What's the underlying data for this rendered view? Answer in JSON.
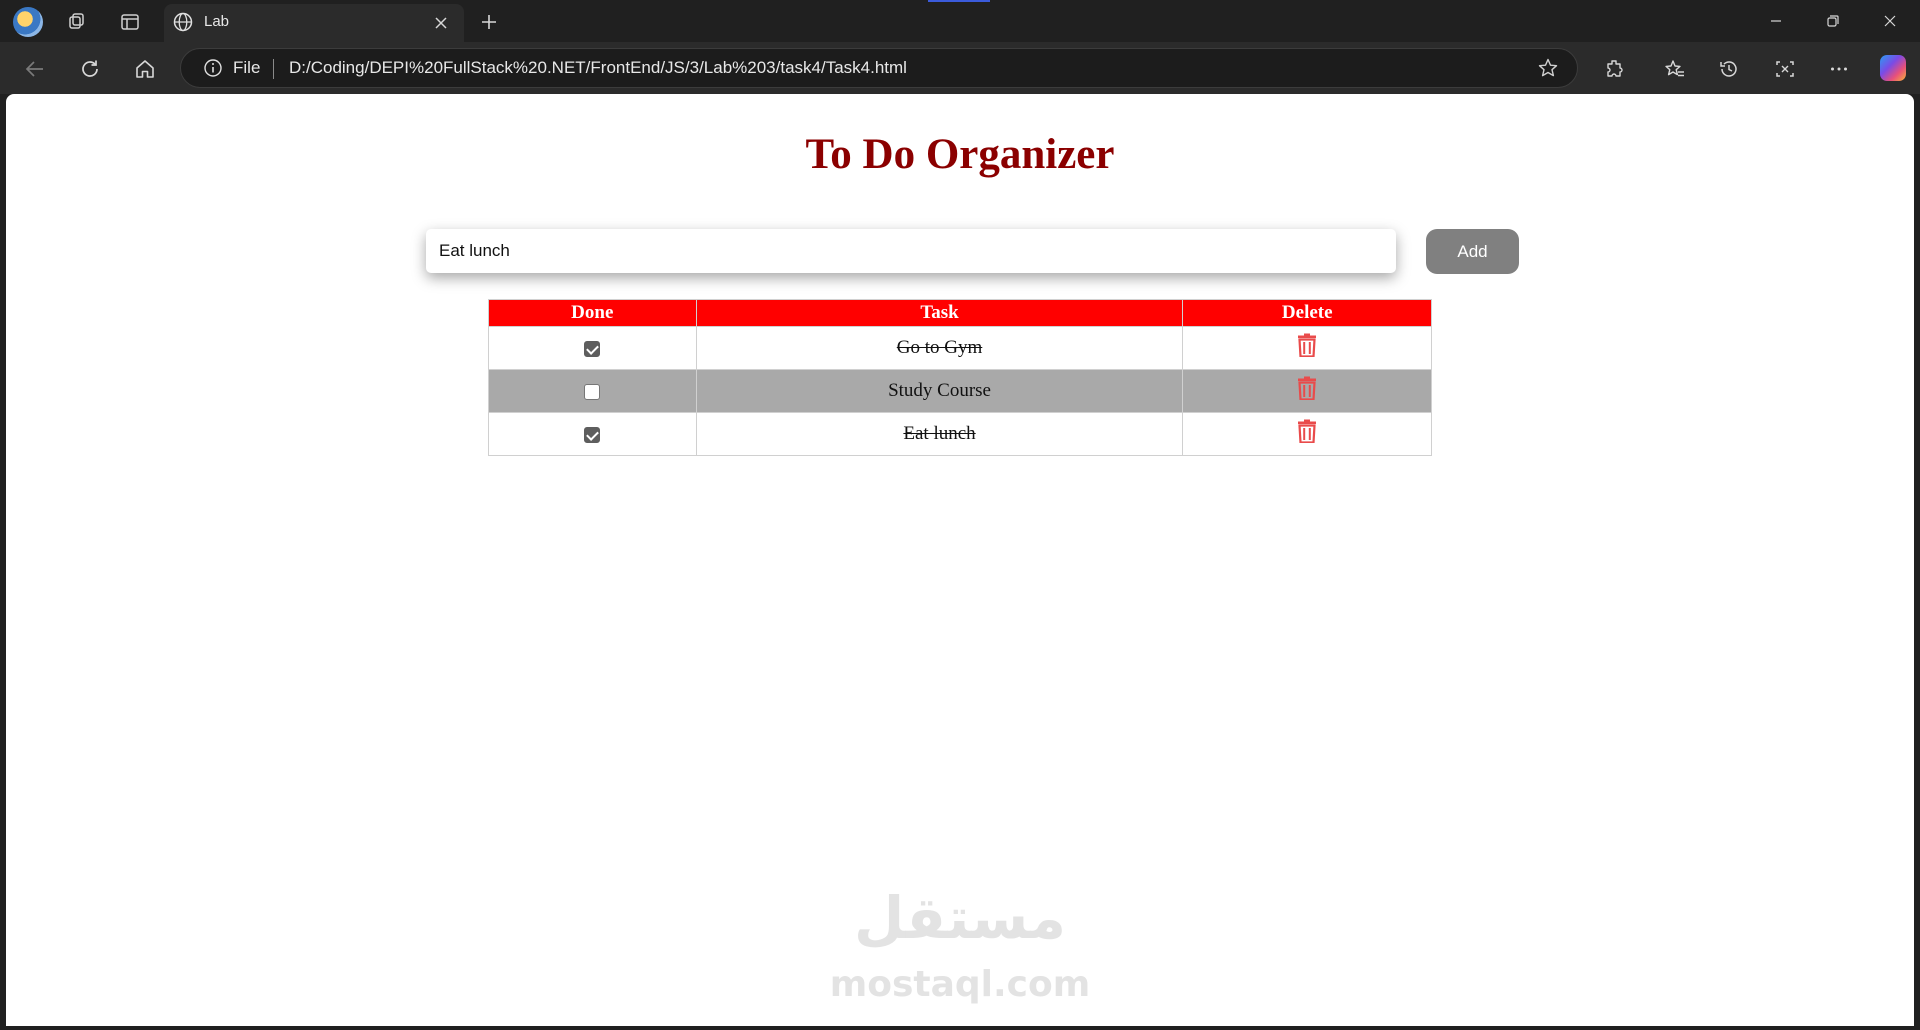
{
  "browser": {
    "tab_title": "Lab",
    "address_scheme": "File",
    "address_url": "D:/Coding/DEPI%20FullStack%20.NET/FrontEnd/JS/3/Lab%203/task4/Task4.html"
  },
  "page": {
    "title": "To Do Organizer",
    "input_value": "Eat lunch",
    "add_label": "Add"
  },
  "table": {
    "headers": {
      "done": "Done",
      "task": "Task",
      "delete": "Delete"
    },
    "rows": [
      {
        "done": true,
        "task": "Go to Gym"
      },
      {
        "done": false,
        "task": "Study Course"
      },
      {
        "done": true,
        "task": "Eat lunch"
      }
    ]
  },
  "watermark": {
    "arabic": "مستقل",
    "latin": "mostaql.com"
  },
  "colors": {
    "title": "#8b0000",
    "header_bg": "#ff0000",
    "alt_row_bg": "#a9a9a9",
    "add_button_bg": "#808080",
    "trash_icon": "#e94b4b"
  }
}
